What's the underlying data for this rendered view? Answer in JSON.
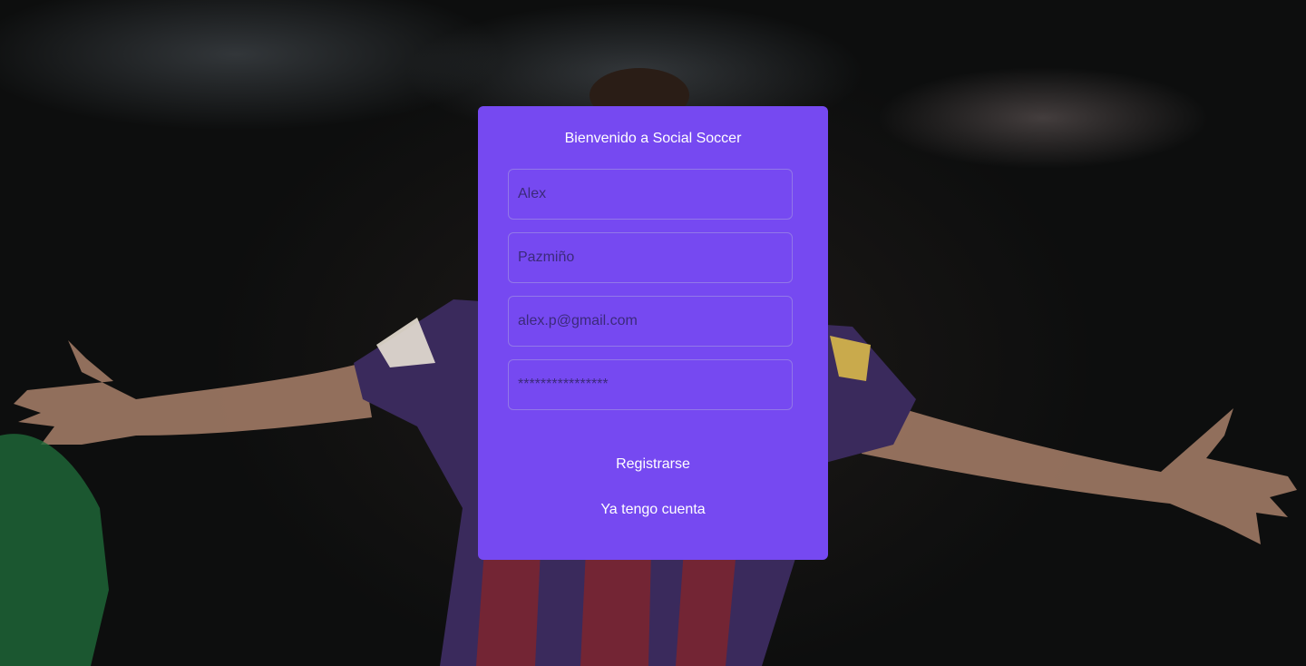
{
  "background": {
    "image": "soccer-player-celebrating",
    "overlay_color": "#0b0c0c"
  },
  "card": {
    "title": "Bienvenido a Social Soccer",
    "background_color": "#7649f1",
    "fields": {
      "first_name": {
        "value": "Alex"
      },
      "last_name": {
        "value": "Pazmiño"
      },
      "email": {
        "value": "alex.p@gmail.com"
      },
      "password": {
        "value": "****************"
      }
    },
    "register_label": "Registrarse",
    "login_label": "Ya tengo cuenta"
  }
}
